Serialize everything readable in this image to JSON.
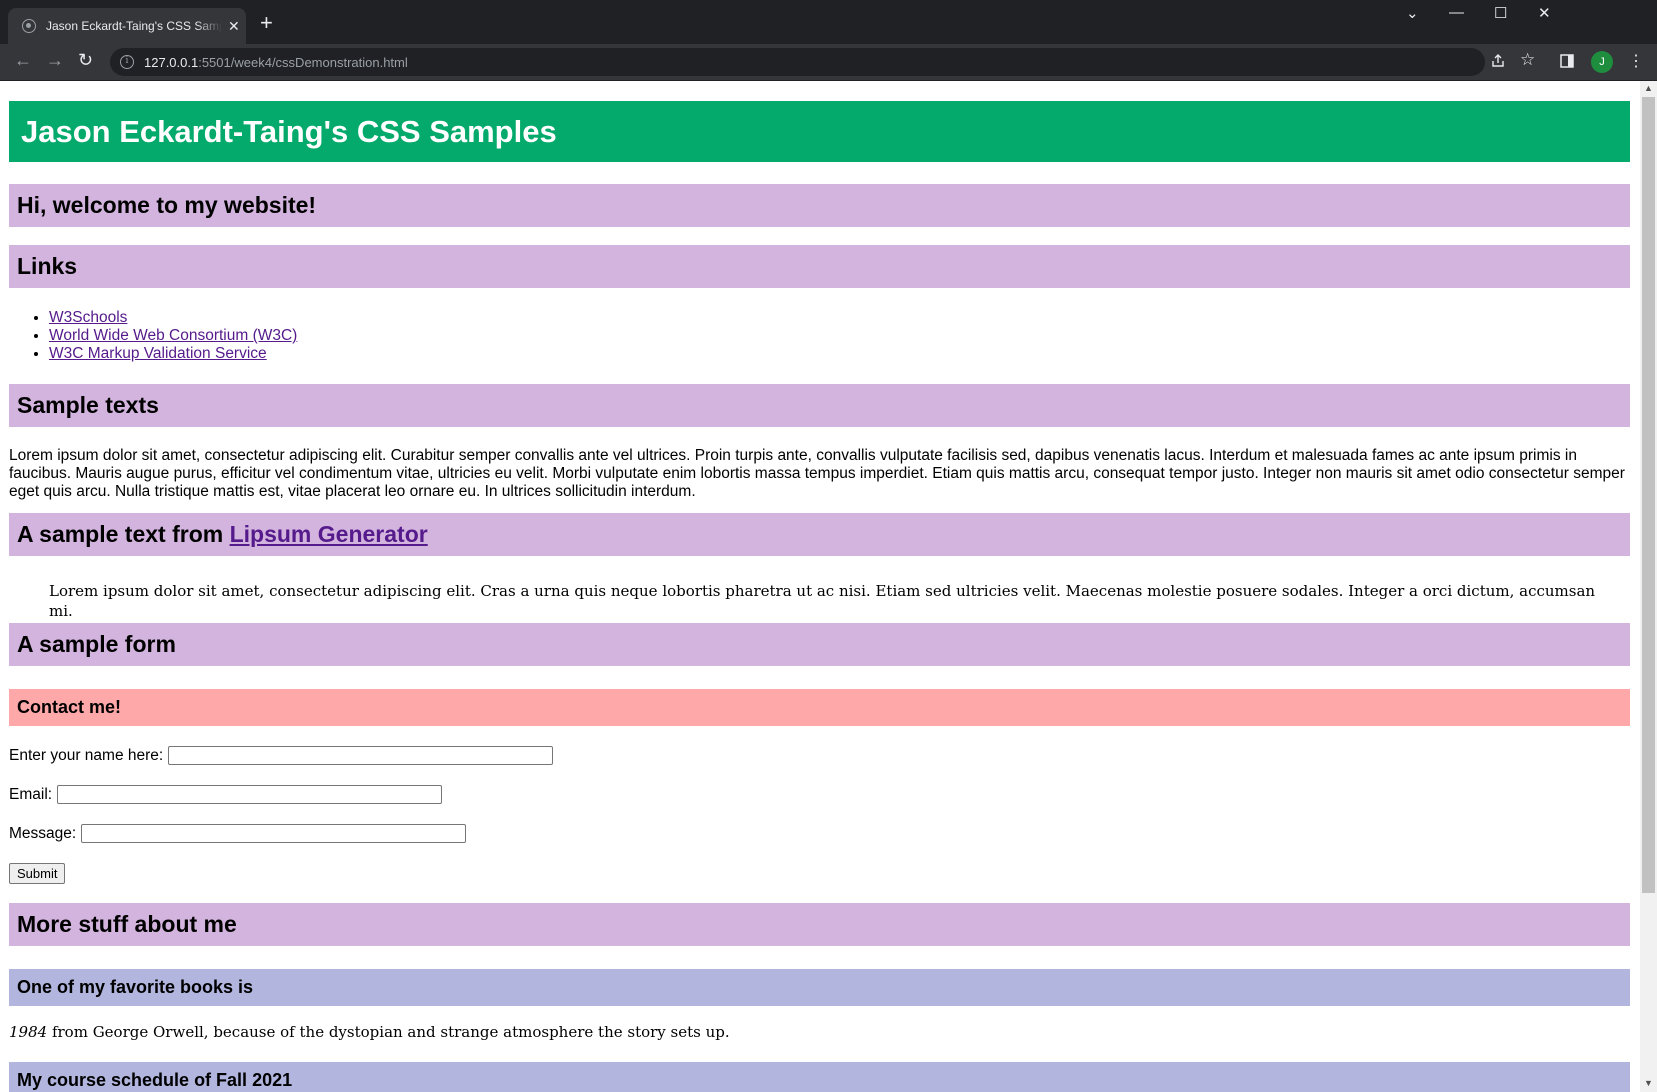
{
  "browser": {
    "tab_title": "Jason Eckardt-Taing's CSS Samples",
    "tab_close": "✕",
    "new_tab": "+",
    "window_controls": {
      "dropdown": "⌄",
      "minimize": "—",
      "maximize": "☐",
      "close": "✕"
    },
    "nav": {
      "back": "←",
      "forward": "→",
      "reload": "↻"
    },
    "url_host": "127.0.0.1",
    "url_path": ":5501/week4/cssDemonstration.html",
    "profile_initial": "J",
    "icons": [
      "info-icon",
      "share-icon",
      "star-icon",
      "side-panel-icon",
      "menu-icon"
    ]
  },
  "page": {
    "banner_title": "Jason Eckardt-Taing's CSS Samples",
    "welcome_heading": "Hi, welcome to my website!",
    "links_heading": "Links",
    "links": [
      {
        "label": "W3Schools"
      },
      {
        "label": "World Wide Web Consortium (W3C)"
      },
      {
        "label": "W3C Markup Validation Service"
      }
    ],
    "sample_texts_heading": "Sample texts",
    "sample_paragraph": "Lorem ipsum dolor sit amet, consectetur adipiscing elit. Curabitur semper convallis ante vel ultrices. Proin turpis ante, convallis vulputate facilisis sed, dapibus venenatis lacus. Interdum et malesuada fames ac ante ipsum primis in faucibus. Mauris augue purus, efficitur vel condimentum vitae, ultricies eu velit. Morbi vulputate enim lobortis massa tempus imperdiet. Etiam quis mattis arcu, consequat tempor justo. Integer non mauris sit amet odio consectetur semper eget quis arcu. Nulla tristique mattis est, vitae placerat leo ornare eu. In ultrices sollicitudin interdum.",
    "lipsum_heading_prefix": "A sample text from ",
    "lipsum_link": "Lipsum Generator",
    "lipsum_quote": "Lorem ipsum dolor sit amet, consectetur adipiscing elit. Cras a urna quis neque lobortis pharetra ut ac nisi. Etiam sed ultricies velit. Maecenas molestie posuere sodales. Integer a orci dictum, accumsan mi.",
    "form_heading": "A sample form",
    "contact_heading": "Contact me!",
    "form": {
      "name_label": "Enter your name here:",
      "name_value": "",
      "email_label": "Email:",
      "email_value": "",
      "message_label": "Message:",
      "message_value": "",
      "submit_label": "Submit"
    },
    "more_heading": "More stuff about me",
    "books_heading": "One of my favorite books is",
    "book_title": "1984",
    "book_text": " from George Orwell, because of the dystopian and strange atmosphere the story sets up.",
    "schedule_heading": "My course schedule of Fall 2021"
  },
  "colors": {
    "banner": "#03aa6b",
    "heading": "#d3b4de",
    "contact": "#ffa8aa",
    "subheading": "#b2b6de",
    "link": "#551a8b"
  }
}
